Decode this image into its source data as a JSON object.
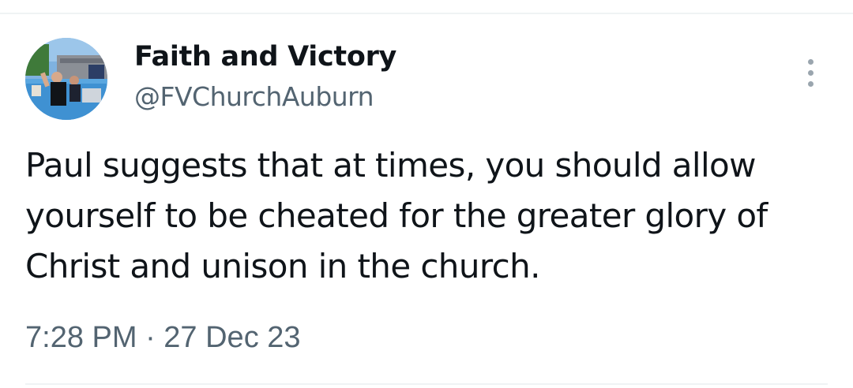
{
  "tweet": {
    "author": {
      "display_name": "Faith and Victory",
      "handle": "@FVChurchAuburn",
      "avatar_icon": "profile-photo"
    },
    "text": "Paul suggests that at times, you should allow yourself to be cheated for the greater glory of Christ and unison in the church.",
    "timestamp": "7:28 PM · 27 Dec 23",
    "more_icon": "more-vertical-icon"
  },
  "colors": {
    "text_primary": "#0f1419",
    "text_secondary": "#536471",
    "divider": "#eff3f4"
  }
}
